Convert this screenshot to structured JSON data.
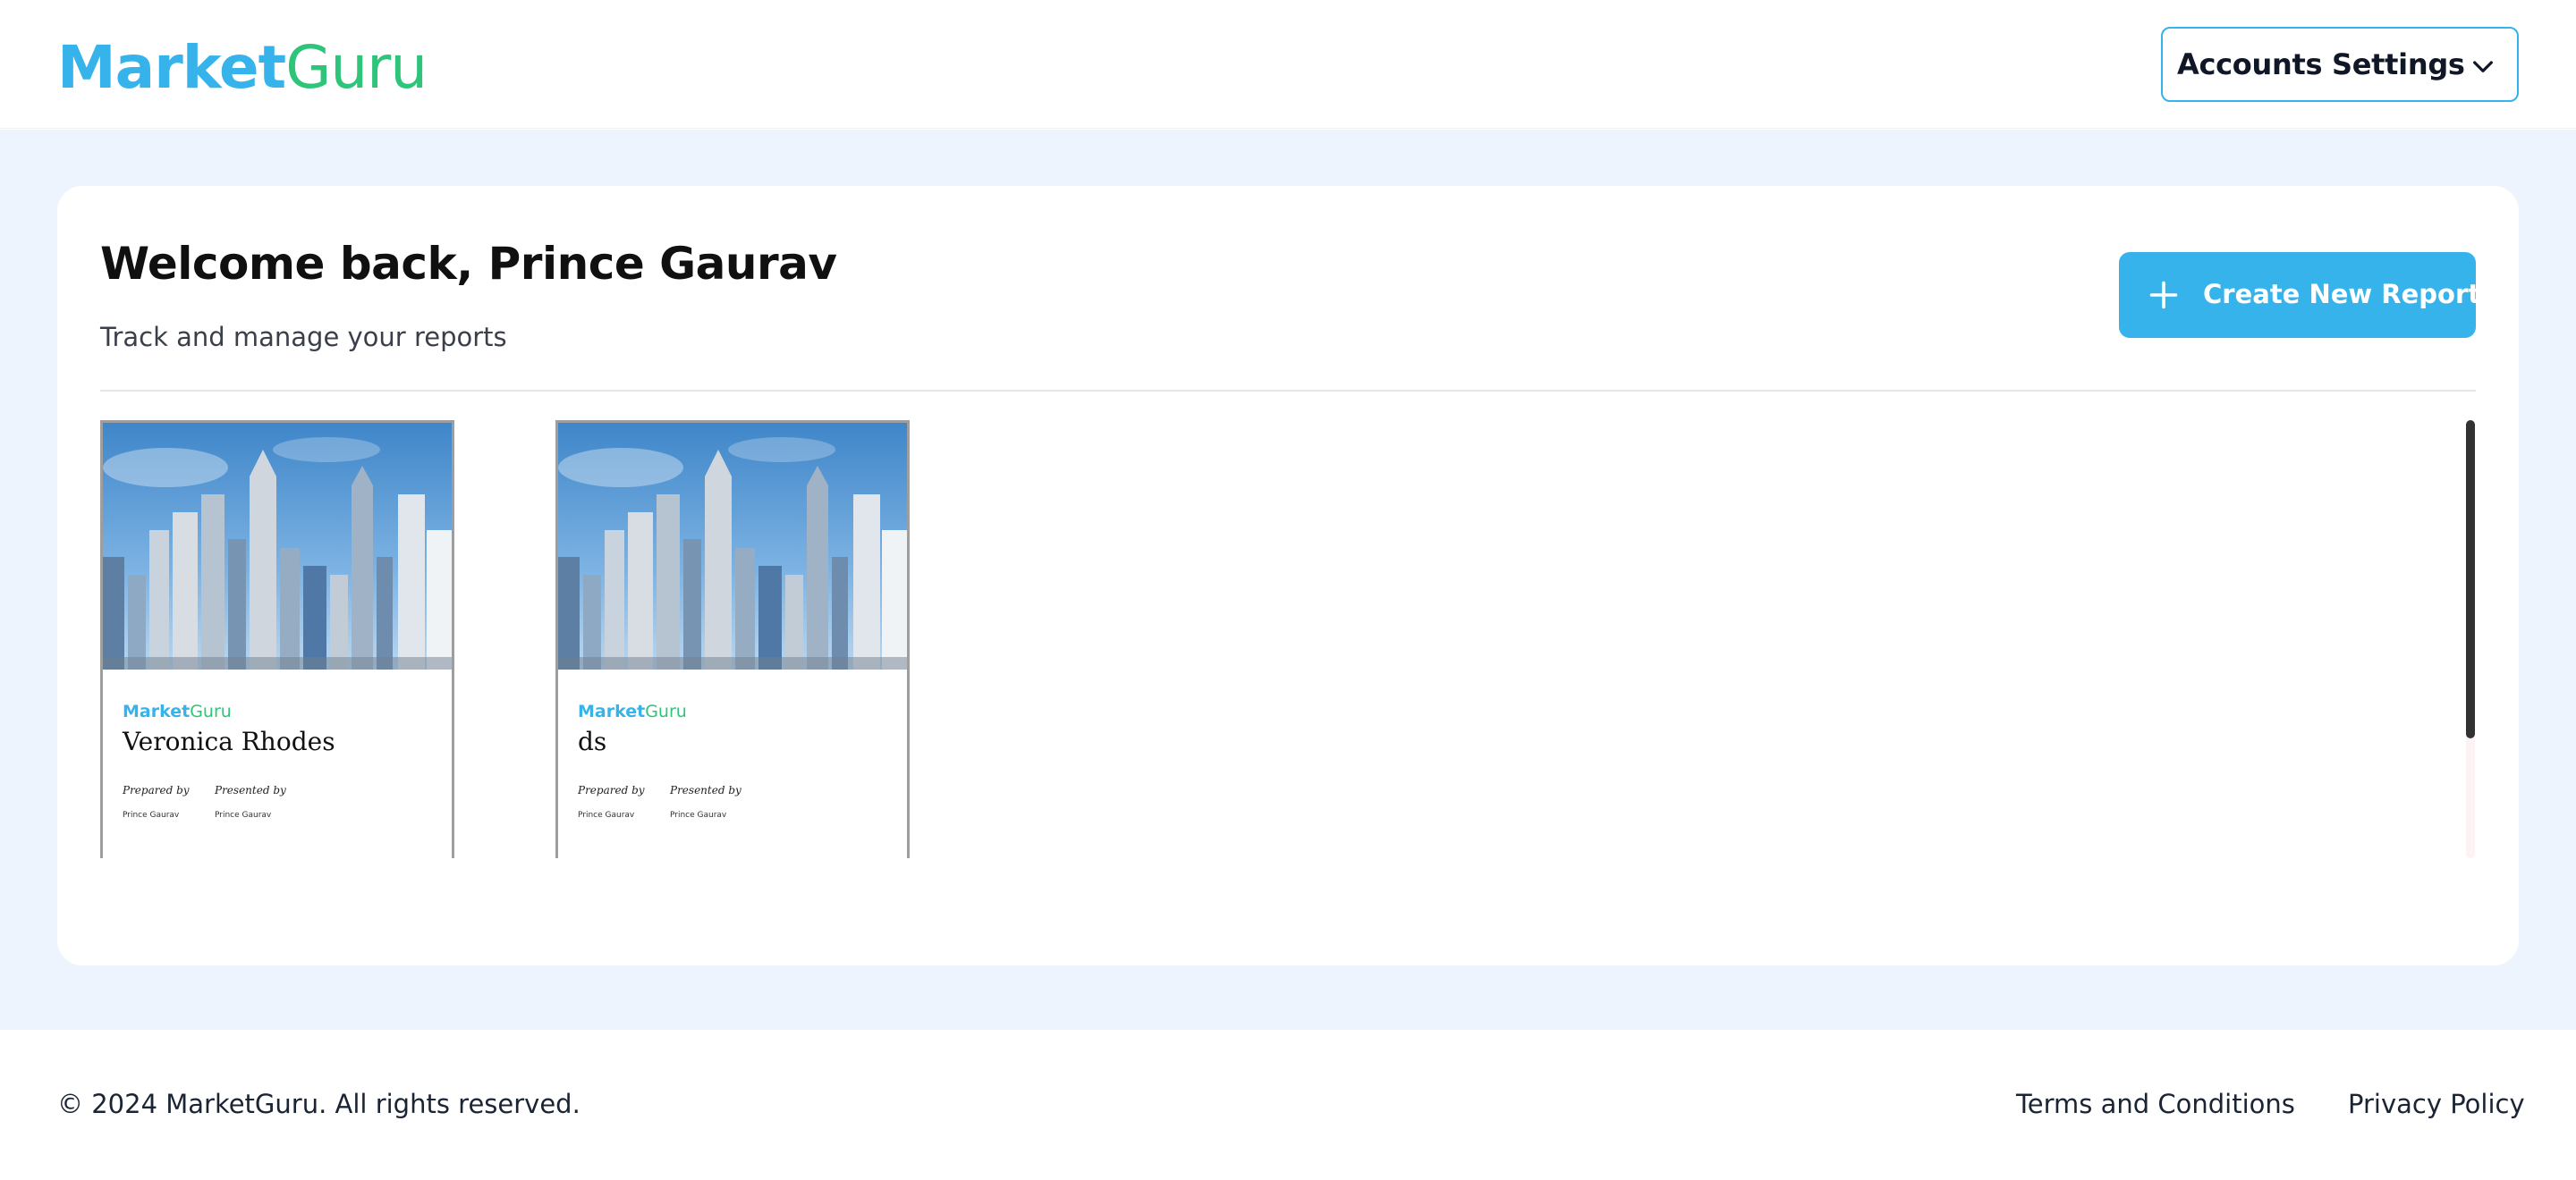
{
  "brand": {
    "name_part1": "Market",
    "name_part2": "Guru",
    "primary_color": "#36b3ea",
    "secondary_color": "#2ec47a"
  },
  "header": {
    "account_button_label": "Accounts Settings",
    "account_icon": "chevron-down-icon"
  },
  "main": {
    "welcome_title": "Welcome back, Prince Gaurav",
    "subtitle": "Track and manage your reports",
    "create_button_label": "Create New Report",
    "create_button_icon": "plus-icon",
    "background_color": "#eef4fd"
  },
  "reports": [
    {
      "title": "Veronica Rhodes",
      "prepared_by_label": "Prepared by",
      "prepared_by": "Prince Gaurav",
      "presented_by_label": "Presented by",
      "presented_by": "Prince Gaurav"
    },
    {
      "title": "ds",
      "prepared_by_label": "Prepared by",
      "prepared_by": "Prince Gaurav",
      "presented_by_label": "Presented by",
      "presented_by": "Prince Gaurav"
    }
  ],
  "footer": {
    "copyright": "© 2024 MarketGuru. All rights reserved.",
    "terms_label": "Terms and Conditions",
    "privacy_label": "Privacy Policy"
  }
}
